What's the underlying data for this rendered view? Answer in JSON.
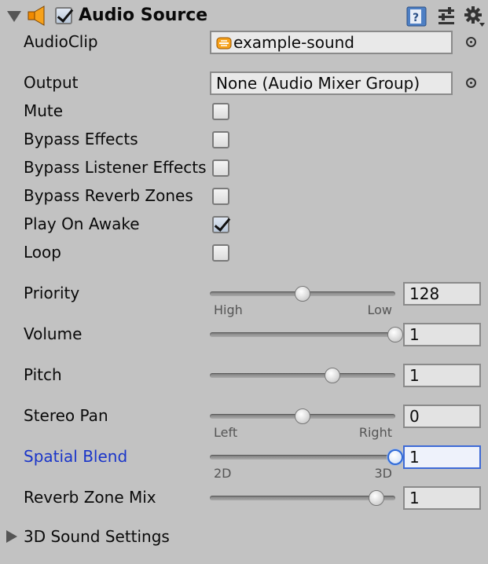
{
  "component": {
    "title": "Audio Source",
    "enabled": true,
    "icons": [
      "speaker-icon",
      "help-icon",
      "presets-icon",
      "gear-icon"
    ]
  },
  "audio_clip": {
    "label": "AudioClip",
    "value": "example-sound",
    "icon": "audio-clip-icon"
  },
  "output": {
    "label": "Output",
    "value": "None (Audio Mixer Group)"
  },
  "toggles": [
    {
      "label": "Mute",
      "checked": false
    },
    {
      "label": "Bypass Effects",
      "checked": false
    },
    {
      "label": "Bypass Listener Effects",
      "checked": false
    },
    {
      "label": "Bypass Reverb Zones",
      "checked": false
    },
    {
      "label": "Play On Awake",
      "checked": true
    },
    {
      "label": "Loop",
      "checked": false
    }
  ],
  "sliders": {
    "priority": {
      "label": "Priority",
      "value": "128",
      "fraction": 0.5,
      "min_label": "High",
      "max_label": "Low"
    },
    "volume": {
      "label": "Volume",
      "value": "1",
      "fraction": 1.0
    },
    "pitch": {
      "label": "Pitch",
      "value": "1",
      "fraction": 0.66
    },
    "stereo_pan": {
      "label": "Stereo Pan",
      "value": "0",
      "fraction": 0.5,
      "min_label": "Left",
      "max_label": "Right"
    },
    "spatial_blend": {
      "label": "Spatial Blend",
      "value": "1",
      "fraction": 1.0,
      "min_label": "2D",
      "max_label": "3D"
    },
    "reverb_zone_mix": {
      "label": "Reverb Zone Mix",
      "value": "1",
      "fraction": 0.9
    }
  },
  "foldout_3d": {
    "label": "3D Sound Settings"
  },
  "colors": {
    "background": "#c2c2c2",
    "accent_blue": "#1a35c9",
    "focus_border": "#3e6ad6"
  }
}
